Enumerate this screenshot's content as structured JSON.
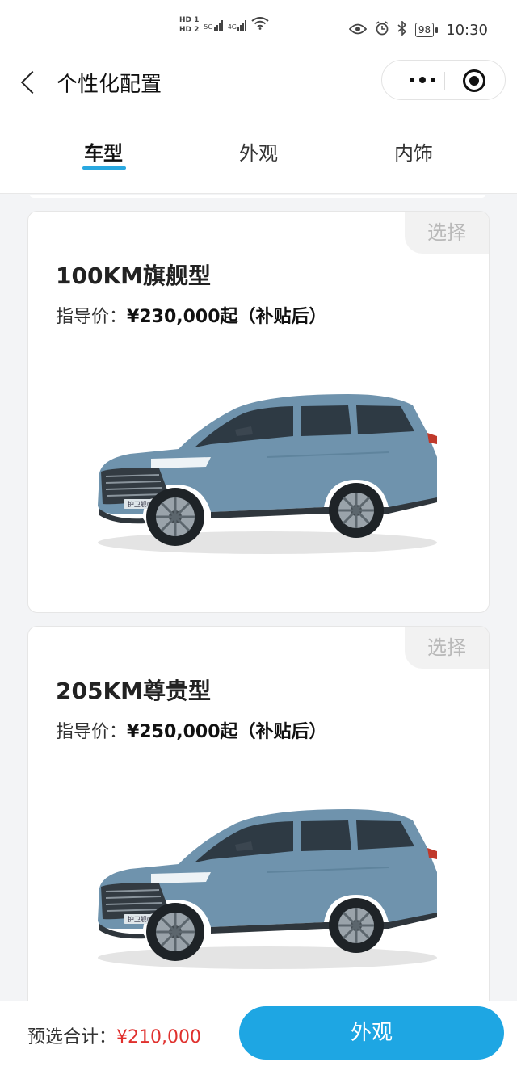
{
  "status_bar": {
    "hd1": "HD 1",
    "hd2": "HD 2",
    "net1": "5G",
    "net2": "4G",
    "battery": "98",
    "time": "10:30"
  },
  "navbar": {
    "title": "个性化配置"
  },
  "tabs": [
    {
      "label": "车型",
      "active": true
    },
    {
      "label": "外观",
      "active": false
    },
    {
      "label": "内饰",
      "active": false
    }
  ],
  "cards": [
    {
      "select_label": "选择",
      "name": "100KM旗舰型",
      "price_label": "指导价：",
      "price_value": "¥230,000起（补贴后）"
    },
    {
      "select_label": "选择",
      "name": "205KM尊贵型",
      "price_label": "指导价：",
      "price_value": "¥250,000起（补贴后）"
    }
  ],
  "car_badge": "护卫舰07",
  "colors": {
    "accent": "#1ea6e3",
    "car_body": "#6f93ad",
    "total_red": "#e0302d"
  },
  "bottom": {
    "total_label": "预选合计：",
    "total_value": "¥210,000",
    "next_label": "外观"
  }
}
